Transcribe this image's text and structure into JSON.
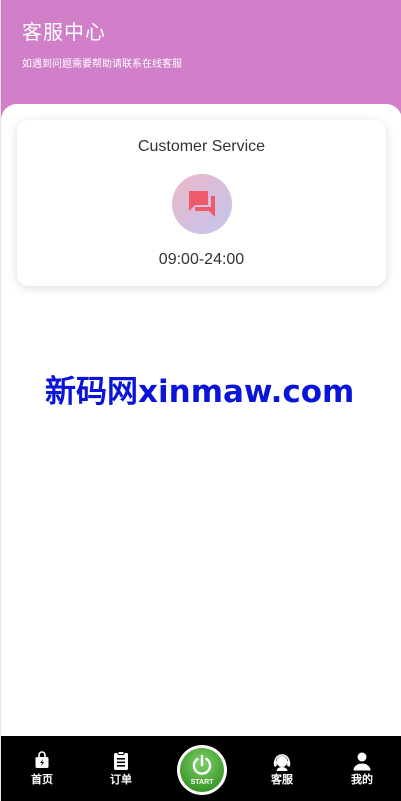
{
  "header": {
    "title": "客服中心",
    "subtitle": "如遇到问题需要帮助请联系在线客服"
  },
  "card": {
    "title": "Customer Service",
    "icon": "chat-bubbles-icon",
    "hours": "09:00-24:00"
  },
  "watermark": "新码网xinmaw.com",
  "tabbar": {
    "items": [
      {
        "label": "首页",
        "icon": "shopping-bag-icon"
      },
      {
        "label": "订单",
        "icon": "clipboard-icon"
      },
      {
        "label": "START",
        "icon": "power-icon"
      },
      {
        "label": "客服",
        "icon": "headset-icon"
      },
      {
        "label": "我的",
        "icon": "user-icon"
      }
    ]
  },
  "colors": {
    "header": "#d07fc8",
    "watermark": "#0b15d8",
    "chat_icon": "#ee5a6a",
    "start_green": "#3f9a2c",
    "tabbar": "#000000"
  }
}
